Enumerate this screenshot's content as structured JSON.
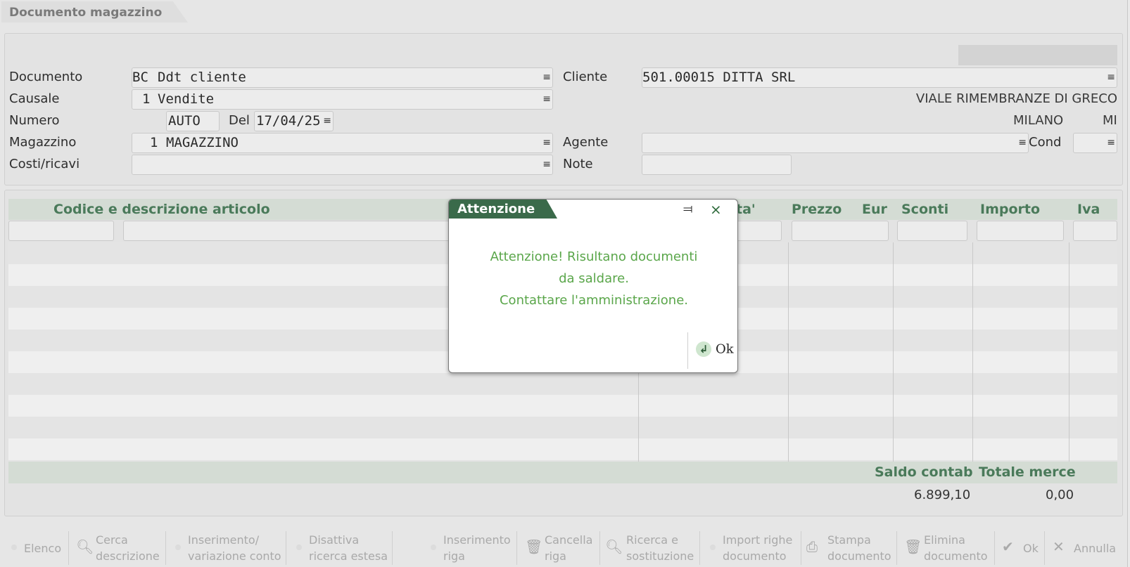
{
  "window": {
    "title": "Documento magazzino"
  },
  "header": {
    "documento": {
      "label": "Documento",
      "code": "BC",
      "value": "Ddt cliente"
    },
    "causale": {
      "label": "Causale",
      "code": "1",
      "value": "Vendite"
    },
    "numero": {
      "label": "Numero",
      "value": "AUTO",
      "del_label": "Del",
      "date": "17/04/25"
    },
    "magazzino": {
      "label": "Magazzino",
      "code": "1",
      "value": "MAGAZZINO"
    },
    "costi": {
      "label": "Costi/ricavi",
      "value": ""
    },
    "cliente": {
      "label": "Cliente",
      "value": "501.00015 DITTA SRL",
      "address": "VIALE RIMEMBRANZE DI GRECO",
      "city": "MILANO",
      "province": "MI"
    },
    "agente": {
      "label": "Agente",
      "value": ""
    },
    "cond": {
      "label": "Cond",
      "value": ""
    },
    "note": {
      "label": "Note",
      "value": ""
    },
    "menu_glyph": "≡"
  },
  "grid": {
    "columns": {
      "articolo": "Codice e descrizione articolo",
      "qta": "ta'",
      "prezzo": "Prezzo",
      "eur": "Eur",
      "sconti": "Sconti",
      "importo": "Importo",
      "iva": "Iva"
    },
    "footer": {
      "saldo_label": "Saldo contab",
      "saldo_value": "6.899,10",
      "totale_label": "Totale merce",
      "totale_value": "0,00"
    }
  },
  "dialog": {
    "title": "Attenzione",
    "line1": "Attenzione! Risultano documenti",
    "line2": "da saldare.",
    "line3": "Contattare l'amministrazione.",
    "ok_label": "Ok"
  },
  "toolbar": {
    "elenco": "Elenco",
    "cerca_1": "Cerca",
    "cerca_2": "descrizione",
    "ins_var_1": "Inserimento/",
    "ins_var_2": "variazione conto",
    "disattiva_1": "Disattiva",
    "disattiva_2": "ricerca estesa",
    "ins_riga_1": "Inserimento",
    "ins_riga_2": "riga",
    "canc_1": "Cancella",
    "canc_2": "riga",
    "ricerca_1": "Ricerca e",
    "ricerca_2": "sostituzione",
    "import_1": "Import righe",
    "import_2": "documento",
    "stampa_1": "Stampa",
    "stampa_2": "documento",
    "elimina_1": "Elimina",
    "elimina_2": "documento",
    "ok": "Ok",
    "annulla": "Annulla"
  }
}
